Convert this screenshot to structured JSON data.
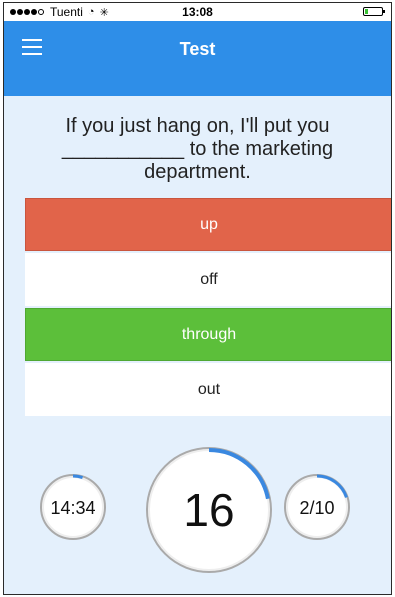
{
  "status_bar": {
    "carrier": "Tuenti",
    "time": "13:08",
    "signal_icon": "signal-dots-icon",
    "wifi_icon": "wifi-icon",
    "activity_icon": "activity-icon",
    "battery_icon": "battery-icon"
  },
  "navbar": {
    "title": "Test",
    "menu_icon": "hamburger-menu-icon",
    "background": "#2e8ee8"
  },
  "question": {
    "line1": "If you just hang on, I'll put you",
    "blank": "___________",
    "line2_rest": " to the marketing",
    "line3": "department."
  },
  "answers": [
    {
      "label": "up",
      "state": "wrong"
    },
    {
      "label": "off",
      "state": "neutral"
    },
    {
      "label": "through",
      "state": "correct"
    },
    {
      "label": "out",
      "state": "neutral"
    }
  ],
  "colors": {
    "wrong": "#e1644a",
    "correct": "#5cbf3a",
    "accent": "#2e8ee8",
    "background": "#e4f0fc"
  },
  "stats": {
    "timer": {
      "value": "14:34",
      "progress": 0.05
    },
    "score": {
      "value": "16",
      "progress": 0.22
    },
    "question_progress": {
      "value": "2/10",
      "progress": 0.2
    }
  }
}
